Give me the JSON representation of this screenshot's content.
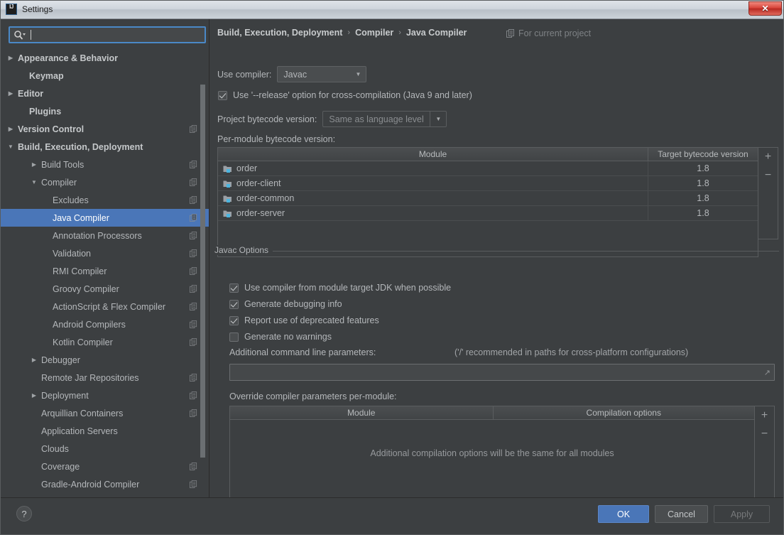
{
  "window": {
    "title": "Settings",
    "logo_icon": "intellij-idea-logo",
    "close_label": "✕"
  },
  "search": {
    "icon": "search-icon",
    "value": "",
    "placeholder": ""
  },
  "sidebar": {
    "items": [
      {
        "label": "Appearance & Behavior",
        "indent": 24,
        "arrow": "▶",
        "bold": true,
        "badge": false,
        "selected": false
      },
      {
        "label": "Keymap",
        "indent": 40,
        "arrow": "",
        "bold": true,
        "badge": false,
        "selected": false
      },
      {
        "label": "Editor",
        "indent": 24,
        "arrow": "▶",
        "bold": true,
        "badge": false,
        "selected": false
      },
      {
        "label": "Plugins",
        "indent": 40,
        "arrow": "",
        "bold": true,
        "badge": false,
        "selected": false
      },
      {
        "label": "Version Control",
        "indent": 24,
        "arrow": "▶",
        "bold": true,
        "badge": true,
        "selected": false
      },
      {
        "label": "Build, Execution, Deployment",
        "indent": 24,
        "arrow": "▼",
        "bold": true,
        "badge": false,
        "selected": false
      },
      {
        "label": "Build Tools",
        "indent": 57,
        "arrow": "▶",
        "bold": false,
        "badge": true,
        "selected": false
      },
      {
        "label": "Compiler",
        "indent": 57,
        "arrow": "▼",
        "bold": false,
        "badge": true,
        "selected": false
      },
      {
        "label": "Excludes",
        "indent": 73,
        "arrow": "",
        "bold": false,
        "badge": true,
        "selected": false
      },
      {
        "label": "Java Compiler",
        "indent": 73,
        "arrow": "",
        "bold": false,
        "badge": true,
        "selected": true
      },
      {
        "label": "Annotation Processors",
        "indent": 73,
        "arrow": "",
        "bold": false,
        "badge": true,
        "selected": false
      },
      {
        "label": "Validation",
        "indent": 73,
        "arrow": "",
        "bold": false,
        "badge": true,
        "selected": false
      },
      {
        "label": "RMI Compiler",
        "indent": 73,
        "arrow": "",
        "bold": false,
        "badge": true,
        "selected": false
      },
      {
        "label": "Groovy Compiler",
        "indent": 73,
        "arrow": "",
        "bold": false,
        "badge": true,
        "selected": false
      },
      {
        "label": "ActionScript & Flex Compiler",
        "indent": 73,
        "arrow": "",
        "bold": false,
        "badge": true,
        "selected": false
      },
      {
        "label": "Android Compilers",
        "indent": 73,
        "arrow": "",
        "bold": false,
        "badge": true,
        "selected": false
      },
      {
        "label": "Kotlin Compiler",
        "indent": 73,
        "arrow": "",
        "bold": false,
        "badge": true,
        "selected": false
      },
      {
        "label": "Debugger",
        "indent": 57,
        "arrow": "▶",
        "bold": false,
        "badge": false,
        "selected": false
      },
      {
        "label": "Remote Jar Repositories",
        "indent": 57,
        "arrow": "",
        "bold": false,
        "badge": true,
        "selected": false
      },
      {
        "label": "Deployment",
        "indent": 57,
        "arrow": "▶",
        "bold": false,
        "badge": true,
        "selected": false
      },
      {
        "label": "Arquillian Containers",
        "indent": 57,
        "arrow": "",
        "bold": false,
        "badge": true,
        "selected": false
      },
      {
        "label": "Application Servers",
        "indent": 57,
        "arrow": "",
        "bold": false,
        "badge": false,
        "selected": false
      },
      {
        "label": "Clouds",
        "indent": 57,
        "arrow": "",
        "bold": false,
        "badge": false,
        "selected": false
      },
      {
        "label": "Coverage",
        "indent": 57,
        "arrow": "",
        "bold": false,
        "badge": true,
        "selected": false
      },
      {
        "label": "Gradle-Android Compiler",
        "indent": 57,
        "arrow": "",
        "bold": false,
        "badge": true,
        "selected": false
      }
    ]
  },
  "breadcrumb": {
    "parts": [
      "Build, Execution, Deployment",
      "Compiler",
      "Java Compiler"
    ],
    "separator": "›",
    "scope_label": "For current project",
    "scope_icon": "project-scope-icon"
  },
  "main": {
    "use_compiler_label": "Use compiler:",
    "use_compiler_value": "Javac",
    "release_option_label": "Use '--release' option for cross-compilation (Java 9 and later)",
    "release_option_checked": true,
    "project_bytecode_label": "Project bytecode version:",
    "project_bytecode_value": "Same as language level",
    "per_module_label": "Per-module bytecode version:",
    "module_table": {
      "headers": [
        "Module",
        "Target bytecode version"
      ],
      "rows": [
        {
          "module": "order",
          "version": "1.8"
        },
        {
          "module": "order-client",
          "version": "1.8"
        },
        {
          "module": "order-common",
          "version": "1.8"
        },
        {
          "module": "order-server",
          "version": "1.8"
        }
      ],
      "add_label": "+",
      "remove_label": "−"
    },
    "javac_group_title": "Javac Options",
    "javac_checkboxes": [
      {
        "label": "Use compiler from module target JDK when possible",
        "checked": true
      },
      {
        "label": "Generate debugging info",
        "checked": true
      },
      {
        "label": "Report use of deprecated features",
        "checked": true
      },
      {
        "label": "Generate no warnings",
        "checked": false
      }
    ],
    "additional_params_label": "Additional command line parameters:",
    "additional_params_hint": "('/' recommended in paths for cross-platform configurations)",
    "additional_params_value": "",
    "override_label": "Override compiler parameters per-module:",
    "override_table": {
      "headers": [
        "Module",
        "Compilation options"
      ],
      "empty_message": "Additional compilation options will be the same for all modules",
      "add_label": "+",
      "remove_label": "−"
    }
  },
  "footer": {
    "help_label": "?",
    "ok_label": "OK",
    "cancel_label": "Cancel",
    "apply_label": "Apply"
  },
  "colors": {
    "background": "#3c3f41",
    "selection": "#4a76b8",
    "accent": "#4a88c7",
    "text": "#b4b7ba",
    "module_icon": "#4bb5e0"
  }
}
